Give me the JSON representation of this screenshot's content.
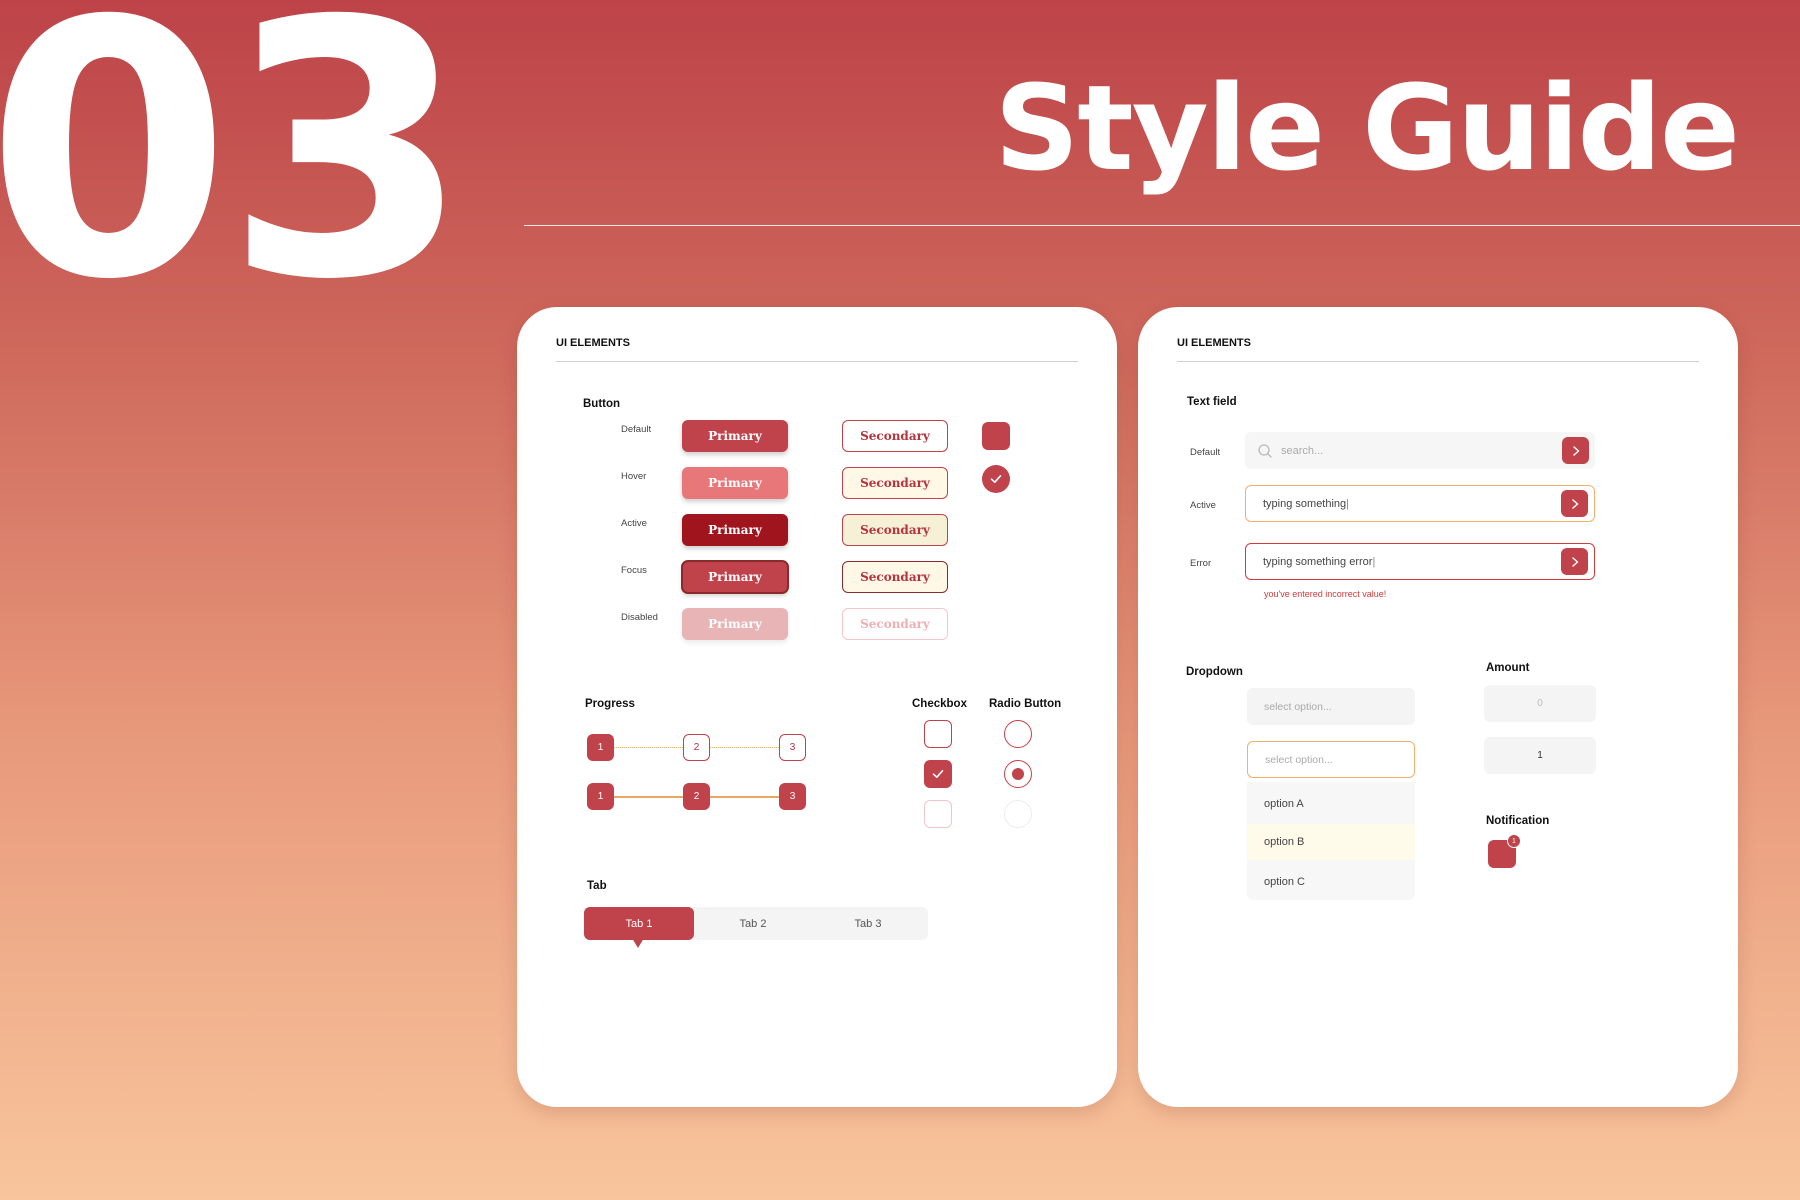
{
  "header": {
    "section_number": "03",
    "title": "Style Guide"
  },
  "left_card": {
    "heading": "UI ELEMENTS",
    "button_section": {
      "label": "Button",
      "states": [
        "Default",
        "Hover",
        "Active",
        "Focus",
        "Disabled"
      ],
      "primary_label": "Primary",
      "secondary_label": "Secondary"
    },
    "progress": {
      "label": "Progress",
      "steps": [
        "1",
        "2",
        "3"
      ]
    },
    "checkbox": {
      "label": "Checkbox"
    },
    "radio": {
      "label": "Radio Button"
    },
    "tab_section": {
      "label": "Tab",
      "tabs": [
        "Tab 1",
        "Tab 2",
        "Tab 3"
      ],
      "active_index": 0
    }
  },
  "right_card": {
    "heading": "UI ELEMENTS",
    "text_field": {
      "label": "Text field",
      "states": [
        "Default",
        "Active",
        "Error"
      ],
      "default_placeholder": "search...",
      "active_value": "typing something",
      "error_value": "typing something error",
      "error_message": "you've entered incorrect value!"
    },
    "dropdown": {
      "label": "Dropdown",
      "placeholder": "select option...",
      "options": [
        "option A",
        "option B",
        "option C"
      ],
      "highlighted_option": "option B"
    },
    "amount": {
      "label": "Amount",
      "values": [
        "0",
        "1"
      ]
    },
    "notification": {
      "label": "Notification",
      "badge_count": "1"
    }
  },
  "colors": {
    "primary": "#c0424a",
    "primary_hover": "#e77779",
    "primary_active": "#a0141d",
    "primary_disabled": "#e8b4b6",
    "secondary_hover_bg": "#fff8e6",
    "secondary_active_bg": "#f5f0d6",
    "focus_outline": "#8a2b2b",
    "active_field_border": "#f2b06c",
    "error": "#d23b3b",
    "accent_line": "#e8a765"
  }
}
